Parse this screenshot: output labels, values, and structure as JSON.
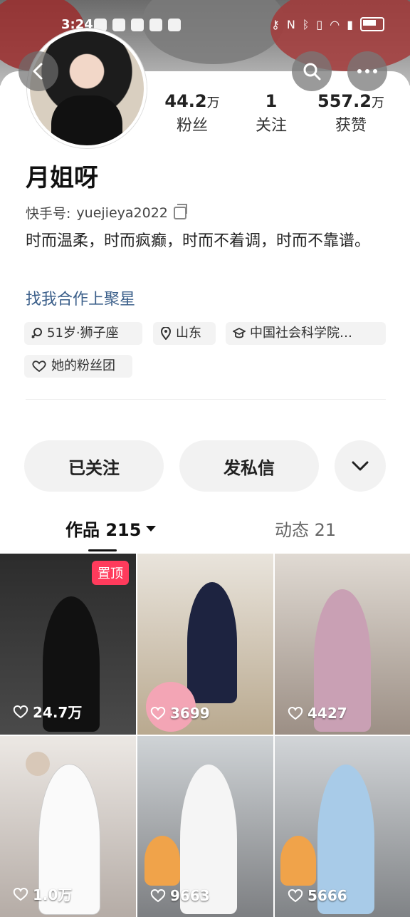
{
  "status_bar": {
    "time": "3:24"
  },
  "profile": {
    "name": "月姐呀",
    "kuaishou_id_label": "快手号:",
    "kuaishou_id": "yuejieya2022",
    "bio": "时而温柔，时而疯癫，时而不着调，时而不靠谱。",
    "link": "找我合作上聚星",
    "stats": [
      {
        "num": "44.2",
        "unit": "万",
        "label": "粉丝"
      },
      {
        "num": "1",
        "unit": "",
        "label": "关注"
      },
      {
        "num": "557.2",
        "unit": "万",
        "label": "获赞"
      }
    ],
    "tags": [
      {
        "icon": "gender-icon",
        "text": "51岁·狮子座"
      },
      {
        "icon": "location-icon",
        "text": "山东"
      },
      {
        "icon": "school-icon",
        "text": "中国社会科学院…"
      },
      {
        "icon": "fan-club-icon",
        "text": "她的粉丝团"
      }
    ]
  },
  "actions": {
    "follow": "已关注",
    "message": "发私信",
    "more_icon": "chevron-down-icon"
  },
  "tabs": {
    "works": "作品 215",
    "moments": "动态 21"
  },
  "videos": [
    {
      "likes": "24.7万",
      "pinned": "置顶"
    },
    {
      "likes": "3699"
    },
    {
      "likes": "4427"
    },
    {
      "likes": "1.0万"
    },
    {
      "likes": "9663"
    },
    {
      "likes": "5666"
    }
  ],
  "icons": {
    "back": "back-arrow-icon",
    "search": "search-icon",
    "more": "more-dots-icon"
  }
}
